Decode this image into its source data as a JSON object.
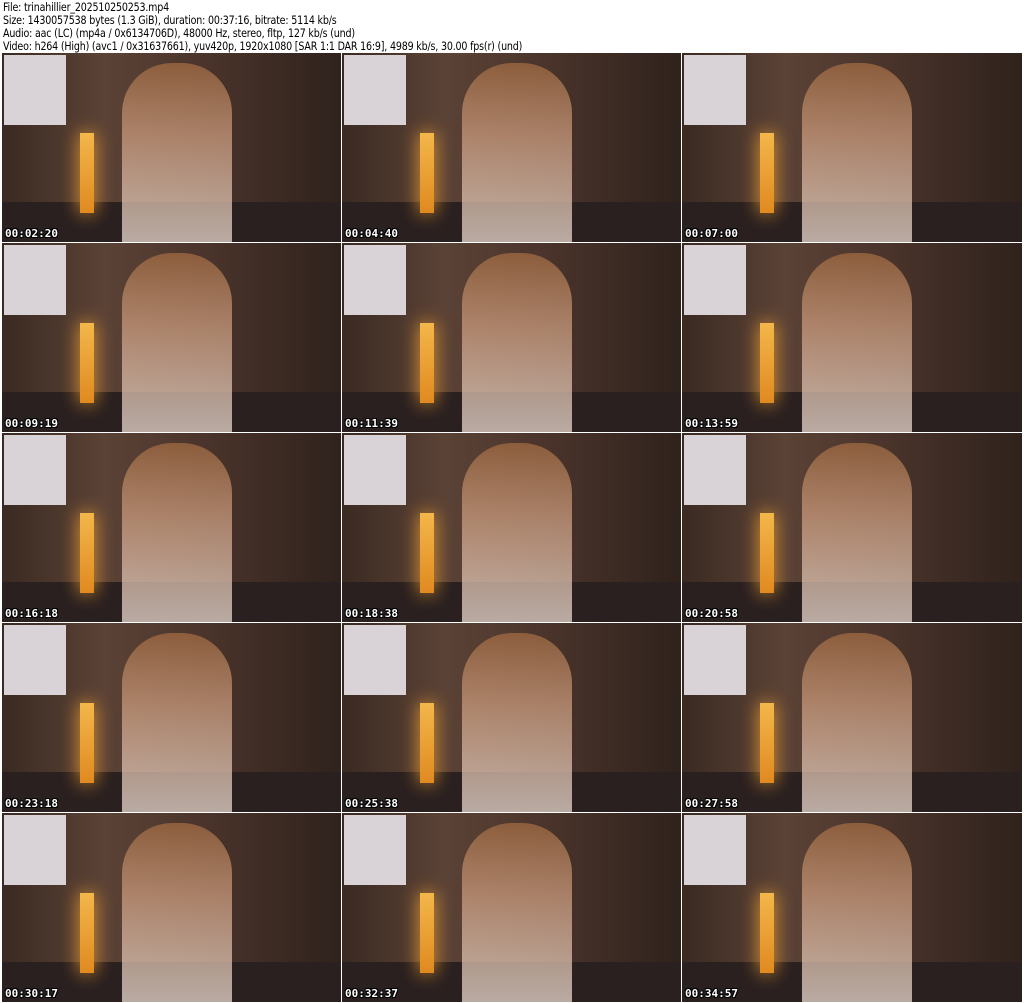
{
  "info": {
    "file": "File: trinahillier_202510250253.mp4",
    "size": "Size: 1430057538 bytes (1.3 GiB), duration: 00:37:16, bitrate: 5114 kb/s",
    "audio": "Audio: aac (LC) (mp4a / 0x6134706D), 48000 Hz, stereo, fltp, 127 kb/s (und)",
    "video": "Video: h264 (High) (avc1 / 0x31637661), yuv420p, 1920x1080 [SAR 1:1 DAR 16:9], 4989 kb/s, 30.00 fps(r) (und)"
  },
  "thumbnails": [
    {
      "time": "00:02:20"
    },
    {
      "time": "00:04:40"
    },
    {
      "time": "00:07:00"
    },
    {
      "time": "00:09:19"
    },
    {
      "time": "00:11:39"
    },
    {
      "time": "00:13:59"
    },
    {
      "time": "00:16:18"
    },
    {
      "time": "00:18:38"
    },
    {
      "time": "00:20:58"
    },
    {
      "time": "00:23:18"
    },
    {
      "time": "00:25:38"
    },
    {
      "time": "00:27:58"
    },
    {
      "time": "00:30:17"
    },
    {
      "time": "00:32:37"
    },
    {
      "time": "00:34:57"
    }
  ]
}
